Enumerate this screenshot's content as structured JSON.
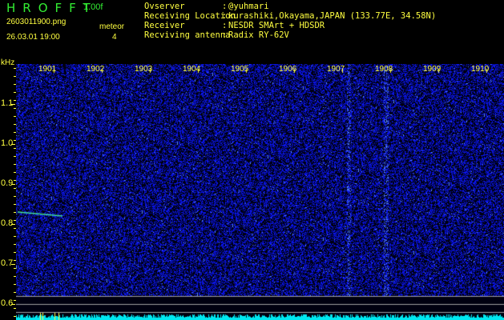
{
  "app": {
    "title": "HROFFT",
    "version": "1.00f"
  },
  "file": {
    "name": "2603011900.png",
    "datetime": "26.03.01 19:00"
  },
  "meteor": {
    "label": "meteor",
    "count": "4"
  },
  "info": [
    {
      "key": "Ovserver",
      "value": "@yuhmari"
    },
    {
      "key": "Receiving Location",
      "value": "kurashiki,Okayama,JAPAN (133.77E, 34.58N)"
    },
    {
      "key": "Receiver",
      "value": "NESDR SMArt + HDSDR"
    },
    {
      "key": "Recviving antenna",
      "value": "Radix RY-62V"
    }
  ],
  "axis": {
    "y_unit": "kHz",
    "x_ticks": [
      "1901",
      "1902",
      "1903",
      "1904",
      "1905",
      "1906",
      "1907",
      "1908",
      "1909",
      "1910"
    ],
    "y_ticks": [
      "1.1",
      "1.0",
      "0.9",
      "0.8",
      "0.7",
      "0.6"
    ]
  },
  "colors": {
    "label": "#ffff40",
    "title": "#33ee33",
    "background": "#000010",
    "noise": "#1a2fd0",
    "level": "#00e8f0"
  }
}
